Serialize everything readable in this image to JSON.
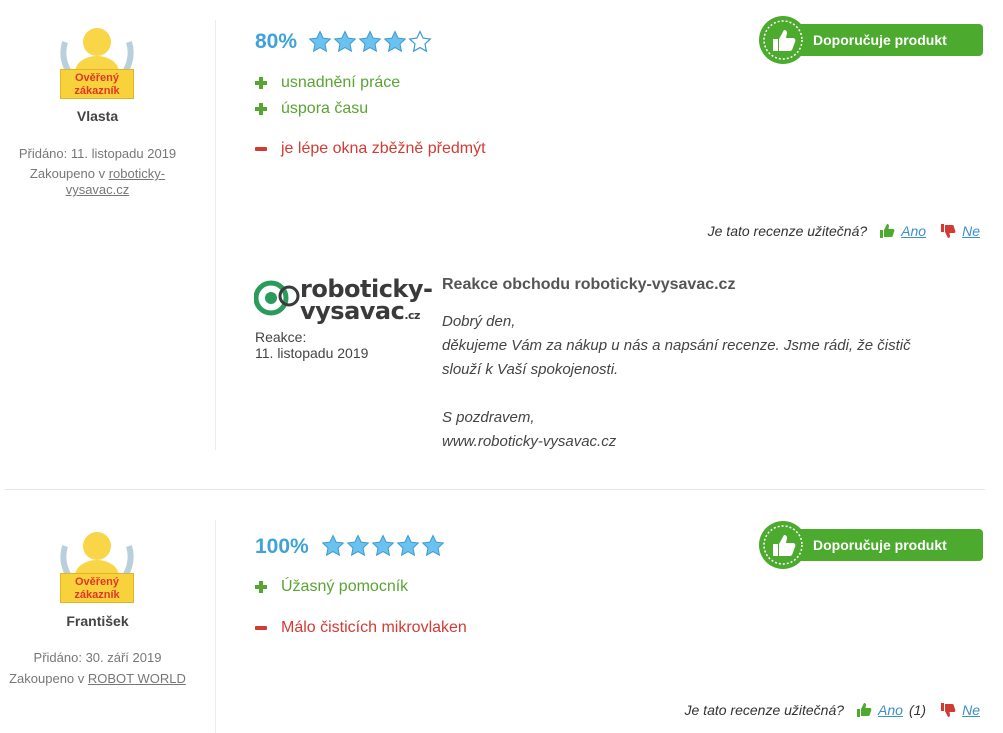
{
  "reviews": [
    {
      "badge_text": "Ověřený zákazník",
      "author": "Vlasta",
      "added_label": "Přidáno: 11. listopadu 2019",
      "purchased_prefix": "Zakoupeno v ",
      "purchased_shop": "roboticky-vysavac.cz",
      "rating_percent": "80%",
      "stars": 4,
      "recommend_label": "Doporučuje produkt",
      "pros": [
        "usnadnění práce",
        "úspora času"
      ],
      "cons": [
        "je lépe okna zběžně předmýt"
      ],
      "useful_question": "Je tato recenze užitečná?",
      "yes_label": "Ano",
      "yes_count": "",
      "no_label": "Ne",
      "reply": {
        "shop_logo_line1": "roboticky-",
        "shop_logo_line2": "vysavac",
        "shop_logo_tld": ".cz",
        "reply_label": "Reakce:",
        "reply_date": "11. listopadu 2019",
        "title": "Reakce obchodu  roboticky-vysavac.cz",
        "lines": [
          "Dobrý den,",
          "děkujeme Vám za nákup u nás a napsání recenze. Jsme rádi, že čistič",
          "slouží k Vaší spokojenosti.",
          "",
          "S pozdravem,",
          "www.roboticky-vysavac.cz"
        ]
      }
    },
    {
      "badge_text": "Ověřený zákazník",
      "author": "František",
      "added_label": "Přidáno: 30. září 2019",
      "purchased_prefix": "Zakoupeno v ",
      "purchased_shop": "ROBOT WORLD",
      "rating_percent": "100%",
      "stars": 5,
      "recommend_label": "Doporučuje produkt",
      "pros": [
        "Úžasný pomocník"
      ],
      "cons": [
        "Málo čisticích mikrovlaken"
      ],
      "useful_question": "Je tato recenze užitečná?",
      "yes_label": "Ano",
      "yes_count": "(1)",
      "no_label": "Ne"
    }
  ],
  "colors": {
    "accent_blue": "#3fa3d8",
    "pro_green": "#5aa433",
    "con_red": "#d23b33",
    "recommend_green": "#4caa2e",
    "badge_yellow": "#f7d23a"
  },
  "icons": {
    "star": "star-icon",
    "plus": "plus-icon",
    "minus": "minus-icon",
    "thumb_up": "thumb-up-icon",
    "thumb_down": "thumb-down-icon",
    "badge": "verified-customer-badge",
    "seal": "recommend-seal-icon"
  }
}
